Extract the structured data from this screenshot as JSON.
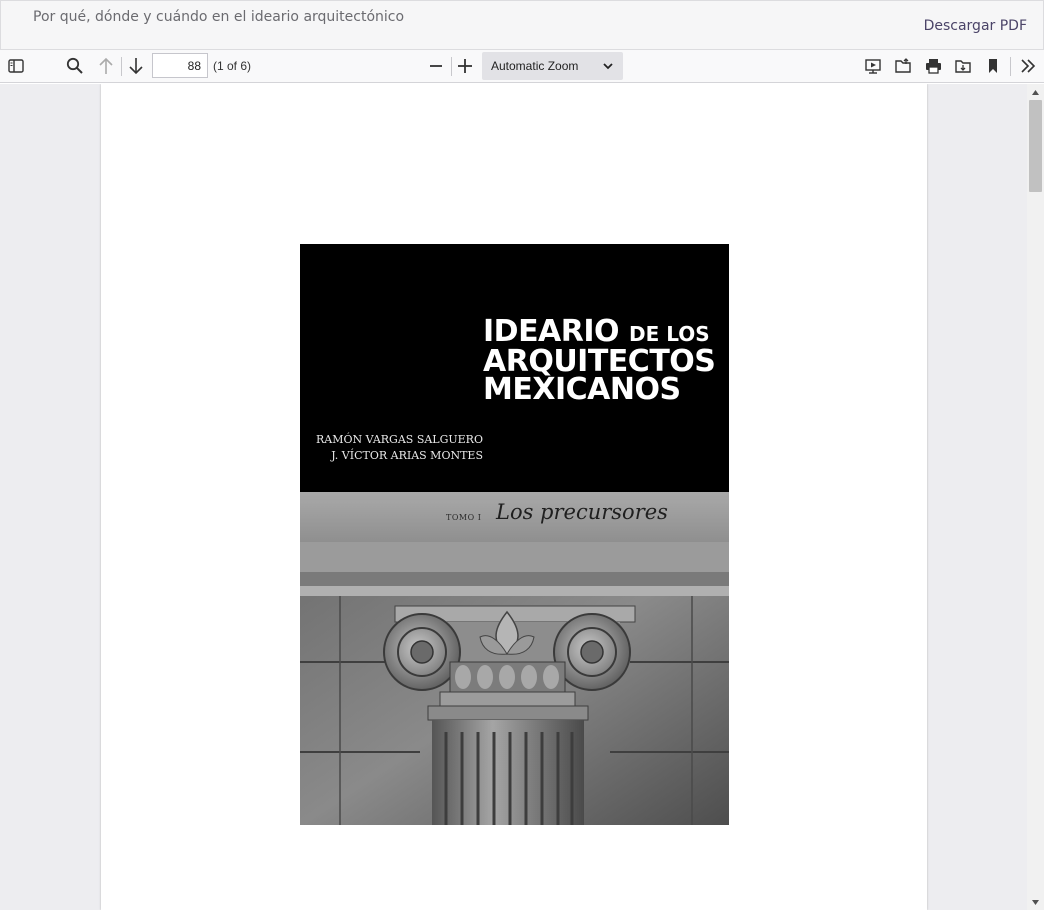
{
  "header": {
    "title": "Por qué, dónde y cuándo en el ideario arquitectónico",
    "download_label": "Descargar PDF"
  },
  "toolbar": {
    "page_number": "88",
    "page_count": "(1 of 6)",
    "zoom_label": "Automatic Zoom"
  },
  "cover": {
    "title_word1": "IDEARIO",
    "title_small": "DE LOS",
    "title_line2": "ARQUITECTOS",
    "title_line3": "MEXICANOS",
    "author1": "RAMÓN VARGAS SALGUERO",
    "author2": "J. VÍCTOR ARIAS MONTES",
    "volume": "TOMO I",
    "subtitle": "Los precursores"
  },
  "colors": {
    "link": "#4b4468",
    "viewer_bg": "#ededf0"
  }
}
